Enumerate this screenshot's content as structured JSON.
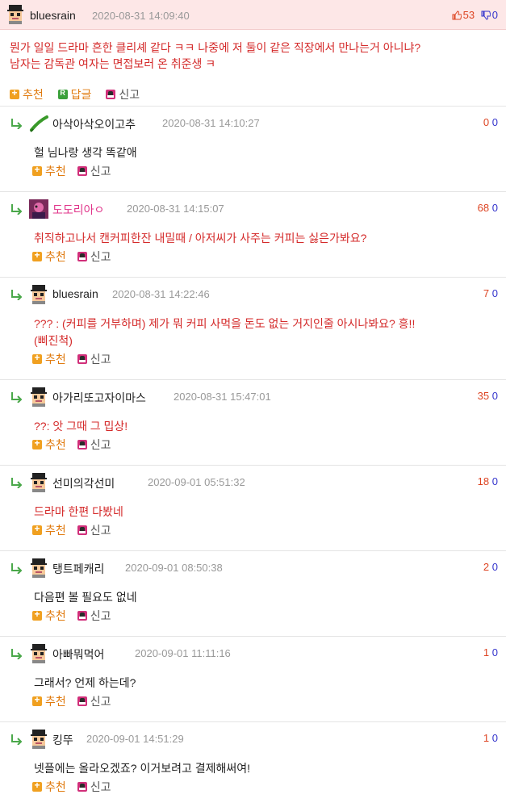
{
  "main": {
    "username": "bluesrain",
    "date": "2020-08-31 14:09:40",
    "upvotes": "53",
    "downvotes": "0",
    "text_line1": "뭔가 일일 드라마 흔한 클리셰 같다 ㅋㅋ 나중에 저 둘이 같은 직장에서 만나는거 아니냐?",
    "text_line2": "남자는 감독관 여자는 면접보러 온 취준생 ㅋ",
    "recommend_label": "추천",
    "reply_label": "답글",
    "report_label": "신고"
  },
  "replies": [
    {
      "username": "아삭아삭오이고추",
      "date": "2020-08-31 14:10:27",
      "up": "0",
      "down": "0",
      "line1": "헐 님나랑 생각 똑같애",
      "line2": "",
      "recommend": "추천",
      "report": "신고"
    },
    {
      "username": "도도리아ㅇ",
      "date": "2020-08-31 14:15:07",
      "up": "68",
      "down": "0",
      "line1": "취직하고나서 캔커피한잔 내밀때 / 아저씨가 사주는 커피는 싫은가봐요?",
      "line2": "",
      "recommend": "추천",
      "report": "신고"
    },
    {
      "username": "bluesrain",
      "date": "2020-08-31 14:22:46",
      "up": "7",
      "down": "0",
      "line1": "??? : (커피를 거부하며) 제가 뭐 커피 사먹을 돈도 없는 거지인줄 아시나봐요? 흥!!",
      "line2": "(삐진척)",
      "recommend": "추천",
      "report": "신고"
    },
    {
      "username": "아가리또고자이마스",
      "date": "2020-08-31 15:47:01",
      "up": "35",
      "down": "0",
      "line1": "??: 앗 그때 그 밉상!",
      "line2": "",
      "recommend": "추천",
      "report": "신고"
    },
    {
      "username": "선미의각선미",
      "date": "2020-09-01 05:51:32",
      "up": "18",
      "down": "0",
      "line1": "드라마 한편 다봤네",
      "line2": "",
      "recommend": "추천",
      "report": "신고"
    },
    {
      "username": "탱트페캐리",
      "date": "2020-09-01 08:50:38",
      "up": "2",
      "down": "0",
      "line1": "다음편 볼 필요도 없네",
      "line2": "",
      "recommend": "추천",
      "report": "신고"
    },
    {
      "username": "아빠뭐먹어",
      "date": "2020-09-01 11:11:16",
      "up": "1",
      "down": "0",
      "line1": "그래서? 언제 하는데?",
      "line2": "",
      "recommend": "추천",
      "report": "신고"
    },
    {
      "username": "킹뚜",
      "date": "2020-09-01 14:51:29",
      "up": "1",
      "down": "0",
      "line1": "넷플에는 올라오겠죠? 이거보려고 결제해써여!",
      "line2": "",
      "recommend": "추천",
      "report": "신고"
    }
  ]
}
